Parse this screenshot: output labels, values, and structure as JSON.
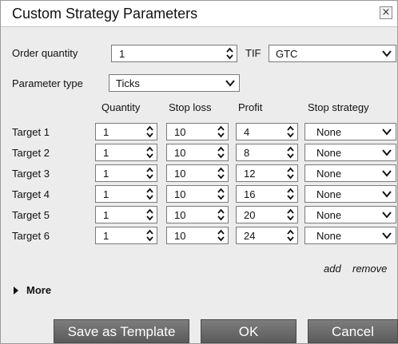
{
  "dialog": {
    "title": "Custom Strategy Parameters",
    "close_glyph": "×"
  },
  "order": {
    "quantity_label": "Order quantity",
    "quantity_value": "1",
    "tif_label": "TIF",
    "tif_value": "GTC",
    "param_type_label": "Parameter type",
    "param_type_value": "Ticks"
  },
  "table": {
    "headers": {
      "quantity": "Quantity",
      "stop_loss": "Stop loss",
      "profit": "Profit",
      "stop_strategy": "Stop strategy"
    },
    "rows": [
      {
        "label": "Target 1",
        "quantity": "1",
        "stop_loss": "10",
        "profit": "4",
        "stop_strategy": "None"
      },
      {
        "label": "Target 2",
        "quantity": "1",
        "stop_loss": "10",
        "profit": "8",
        "stop_strategy": "None"
      },
      {
        "label": "Target 3",
        "quantity": "1",
        "stop_loss": "10",
        "profit": "12",
        "stop_strategy": "None"
      },
      {
        "label": "Target 4",
        "quantity": "1",
        "stop_loss": "10",
        "profit": "16",
        "stop_strategy": "None"
      },
      {
        "label": "Target 5",
        "quantity": "1",
        "stop_loss": "10",
        "profit": "20",
        "stop_strategy": "None"
      },
      {
        "label": "Target 6",
        "quantity": "1",
        "stop_loss": "10",
        "profit": "24",
        "stop_strategy": "None"
      }
    ]
  },
  "links": {
    "add": "add",
    "remove": "remove"
  },
  "more_label": "More",
  "buttons": {
    "save_template": "Save as Template",
    "ok": "OK",
    "cancel": "Cancel"
  },
  "icons": {
    "spinner": "spinner-arrows-icon",
    "dropdown": "chevron-down-icon",
    "expand": "triangle-right-icon",
    "close": "close-icon"
  },
  "colors": {
    "button_bg": "#6a6a6a",
    "dialog_bg": "#ececec",
    "titlebar_bg": "#ffffff"
  }
}
